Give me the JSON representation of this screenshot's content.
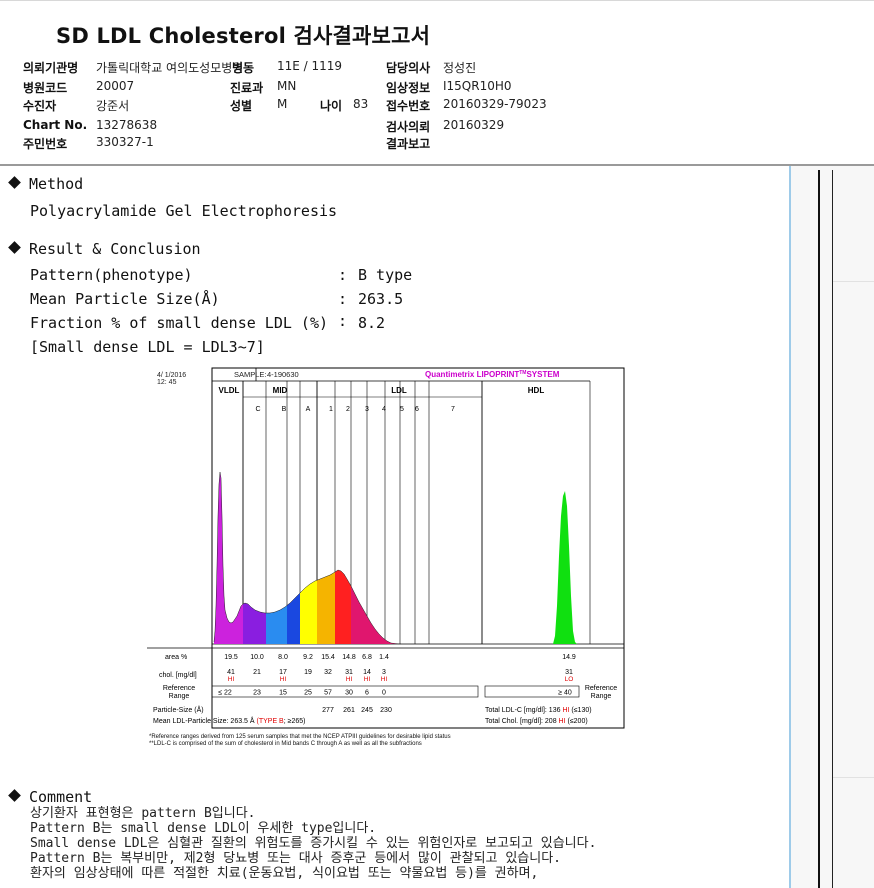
{
  "title": "SD LDL Cholesterol 검사결과보고서",
  "patient": {
    "inst_label": "의뢰기관명",
    "inst_value": "가톨릭대학교 여의도성모병원",
    "ward_label": "병동",
    "ward_value": "11E / 1119",
    "doctor_label": "담당의사",
    "doctor_value": "정성진",
    "code_label": "병원코드",
    "code_value": "20007",
    "dept_label": "진료과",
    "dept_value": "MN",
    "clinical_label": "임상정보",
    "clinical_value": "I15QR10H0",
    "name_label": "수진자",
    "name_value": "강준서",
    "sex_label": "성별",
    "sex_value": "M",
    "age_label": "나이",
    "age_value": "83",
    "receipt_label": "접수번호",
    "receipt_value": "20160329-79023",
    "chart_label": "Chart No.",
    "chart_value": "13278638",
    "reqdate_label": "검사의뢰",
    "reqdate_value": "20160329",
    "id_label": "주민번호",
    "id_value": "330327-1",
    "report_label": "결과보고",
    "report_value": ""
  },
  "method": {
    "heading": "Method",
    "text": "Polyacrylamide Gel Electrophoresis"
  },
  "result": {
    "heading": "Result & Conclusion",
    "rows": [
      {
        "label": "Pattern(phenotype)",
        "value": "B type"
      },
      {
        "label": "Mean Particle Size(Å)",
        "value": "263.5"
      },
      {
        "label": "Fraction % of small dense LDL (%)",
        "value": "8.2"
      }
    ],
    "note": "[Small dense LDL = LDL3~7]",
    "colon": ":"
  },
  "chart_data": {
    "type": "area",
    "date": "4/ 1/2016",
    "time": "12: 45",
    "sample_label": "SAMPLE:",
    "sample_value": "4-190630",
    "brand": "Quantimetrix LIPOPRINT",
    "brand_sup": "TM",
    "brand_tail": "SYSTEM",
    "group_labels": [
      "VLDL",
      "MID",
      "LDL",
      "HDL"
    ],
    "band_labels": [
      "C",
      "B",
      "A",
      "1",
      "2",
      "3",
      "4",
      "5",
      "6",
      "7"
    ],
    "row_labels": {
      "area": "area %",
      "chol": "chol. [mg/dl]",
      "ref": "Reference Range",
      "ref_right": "Reference Range",
      "psize": "Particle-Size (Å)",
      "mean": "Mean LDL-Particle Size:"
    },
    "area_values": [
      "19.5",
      "10.0",
      "8.0",
      "9.2",
      "15.4",
      "14.8",
      "6.8",
      "1.4",
      "14.9"
    ],
    "chol_values": [
      "41",
      "21",
      "17",
      "19",
      "32",
      "31",
      "14",
      "3",
      "31"
    ],
    "chol_flags": [
      "HI",
      "",
      "HI",
      "",
      "",
      "HI",
      "HI",
      "HI",
      "LO"
    ],
    "ref_values": [
      "≤ 22",
      "23",
      "15",
      "25",
      "57",
      "30",
      "6",
      "0",
      "≥ 40"
    ],
    "particle_sizes": [
      "277",
      "261",
      "245",
      "230"
    ],
    "mean_size": "263.5 Å",
    "mean_type": "(TYPE B",
    "mean_tail": "; ≥265)",
    "total_ldl_label": "Total LDL-C [mg/dl]:",
    "total_ldl_value": "136",
    "total_ldl_flag": "HI",
    "total_ldl_ref": "(≤130)",
    "total_chol_label": "Total Chol. [mg/dl]:",
    "total_chol_value": "208",
    "total_chol_flag": "HI",
    "total_chol_ref": "(≤200)",
    "footnote1": "*Reference ranges derived from 125 serum samples that met the NCEP ATPIII guidelines for desirable lipid status",
    "footnote2": "**LDL-C is comprised of the sum of cholesterol in Mid bands C through A as well as all the subfractions",
    "fractions": [
      {
        "name": "VLDL",
        "color": "#cc22dd"
      },
      {
        "name": "MID C",
        "color": "#8a1ee0"
      },
      {
        "name": "MID B",
        "color": "#2a8cf0"
      },
      {
        "name": "MID A",
        "color": "#1a48e0"
      },
      {
        "name": "LDL1",
        "color": "#ffff00"
      },
      {
        "name": "LDL2",
        "color": "#f5b400"
      },
      {
        "name": "LDL3",
        "color": "#ff2020"
      },
      {
        "name": "LDL4",
        "color": "#e0166e"
      },
      {
        "name": "HDL",
        "color": "#10e010"
      }
    ]
  },
  "comment": {
    "heading": "Comment",
    "lines": [
      "상기환자 표현형은 pattern B입니다.",
      "Pattern B는 small dense LDL이 우세한 type입니다.",
      "Small dense LDL은 심혈관 질환의 위험도를 증가시킬 수 있는 위험인자로 보고되고 있습니다.",
      "Pattern B는 복부비만, 제2형 당뇨병 또는 대사 증후군 등에서 많이 관찰되고 있습니다.",
      "환자의 임상상태에 따른 적절한 치료(운동요법, 식이요법 또는 약물요법 등)를 권하며,"
    ]
  }
}
